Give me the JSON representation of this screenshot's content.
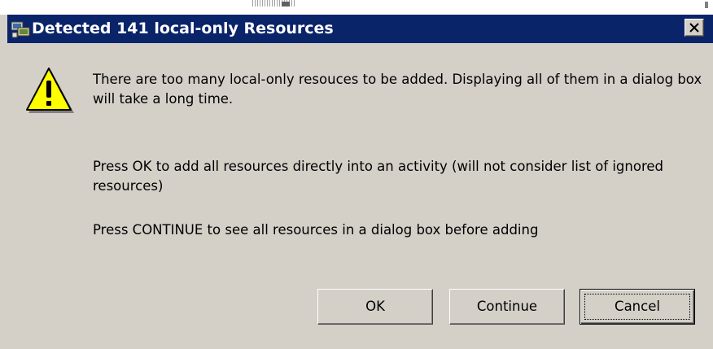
{
  "dialog": {
    "title": "Detected 141 local-only Resources",
    "title_icon": "resources-app-icon",
    "close_icon": "close-icon",
    "warning_icon": "warning-triangle-icon",
    "message_1": "There are too many local-only resouces to be added. Displaying all of them in a dialog box will take a long time.",
    "message_2": "Press OK to add all resources directly into an activity (will not consider list of ignored resources)",
    "message_3": "Press CONTINUE to see all resources in a dialog box before adding",
    "buttons": {
      "ok": "OK",
      "continue": "Continue",
      "cancel": "Cancel"
    },
    "colors": {
      "titlebar": "#0a246a",
      "title_text": "#ffffff",
      "dialog_bg": "#d4d0c8",
      "warning_fill": "#ffff00"
    }
  }
}
